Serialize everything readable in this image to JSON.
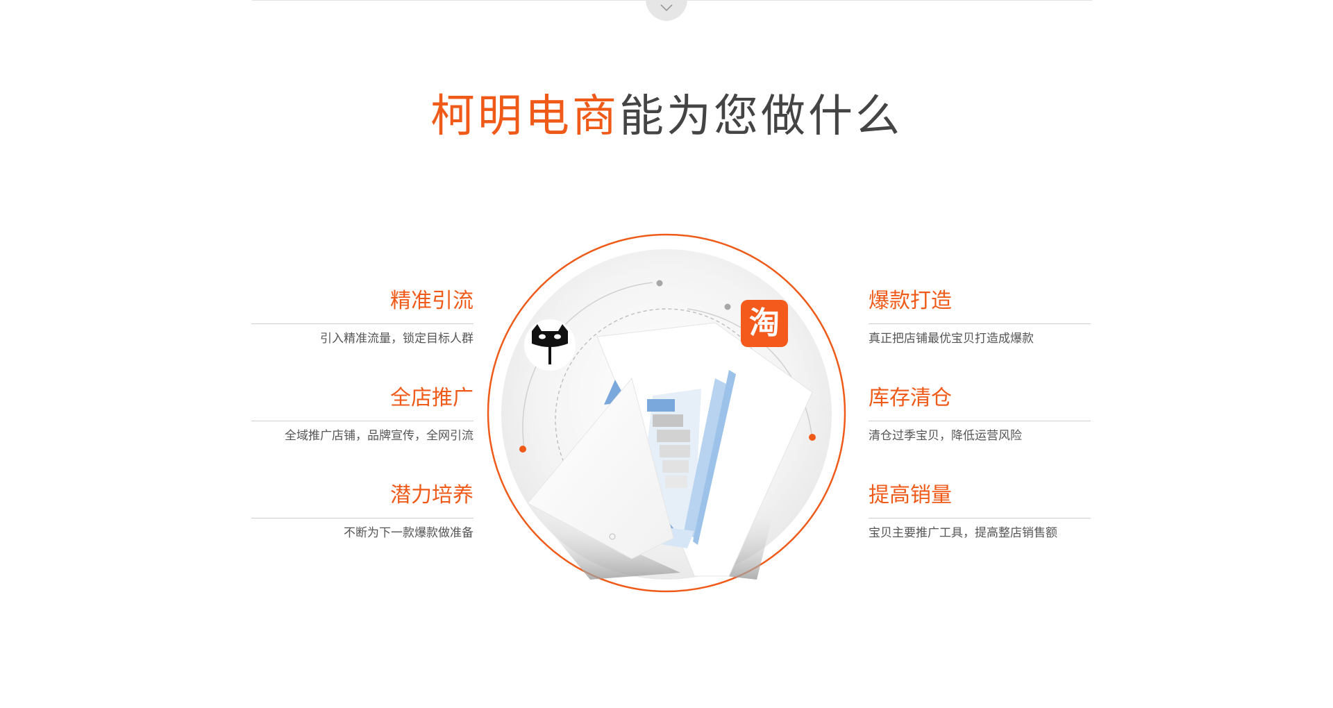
{
  "header": {
    "title_accent": "柯明电商",
    "title_rest": "能为您做什么"
  },
  "features_left": [
    {
      "title": "精准引流",
      "desc": "引入精准流量，锁定目标人群"
    },
    {
      "title": "全店推广",
      "desc": "全域推广店铺，品牌宣传，全网引流"
    },
    {
      "title": "潜力培养",
      "desc": "不断为下一款爆款做准备"
    }
  ],
  "features_right": [
    {
      "title": "爆款打造",
      "desc": "真正把店铺最优宝贝打造成爆款"
    },
    {
      "title": "库存清仓",
      "desc": "清仓过季宝贝，降低运营风险"
    },
    {
      "title": "提高销量",
      "desc": "宝贝主要推广工具，提高整店销售额"
    }
  ],
  "hub": {
    "taobao_glyph": "淘",
    "tmall_icon": "tmall-cat-icon",
    "colors": {
      "accent": "#f05a19",
      "inner_disk": "#f3f3f3",
      "chart_blue": "#7aa8dd"
    }
  }
}
